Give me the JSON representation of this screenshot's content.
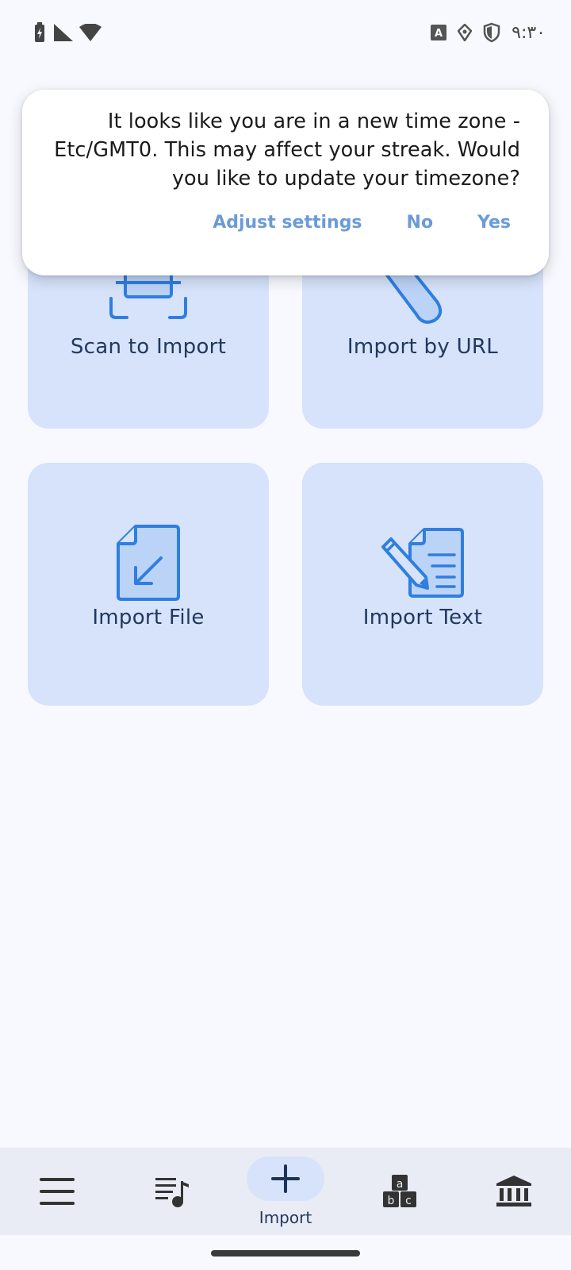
{
  "status_bar": {
    "time": "۹:۳۰",
    "left_icons": [
      "battery-charging-icon",
      "cell-signal-icon",
      "wifi-icon"
    ],
    "right_icons": [
      "keyboard-a-icon",
      "location-icon",
      "shield-icon"
    ]
  },
  "dialog": {
    "message": "It looks like you are in a new time zone - Etc/GMT0. This may affect your streak. Would you like to update your timezone?",
    "buttons": {
      "adjust": "Adjust settings",
      "no": "No",
      "yes": "Yes"
    }
  },
  "cards": [
    {
      "label": "Scan to Import",
      "icon": "scan-icon"
    },
    {
      "label": "Import by URL",
      "icon": "link-icon"
    },
    {
      "label": "Import File",
      "icon": "file-import-icon"
    },
    {
      "label": "Import Text",
      "icon": "text-document-pencil-icon"
    }
  ],
  "bottom_nav": {
    "items": [
      {
        "icon": "menu-icon",
        "label": ""
      },
      {
        "icon": "playlist-music-icon",
        "label": ""
      },
      {
        "icon": "plus-icon",
        "label": "Import",
        "active": true
      },
      {
        "icon": "alphabet-blocks-icon",
        "label": ""
      },
      {
        "icon": "library-icon",
        "label": ""
      }
    ]
  },
  "colors": {
    "background": "#f8f9ff",
    "card": "#d6e3fb",
    "accent": "#2f7ee0",
    "dialog_button": "#6b9bd6",
    "nav_background": "#e9ecf4"
  }
}
